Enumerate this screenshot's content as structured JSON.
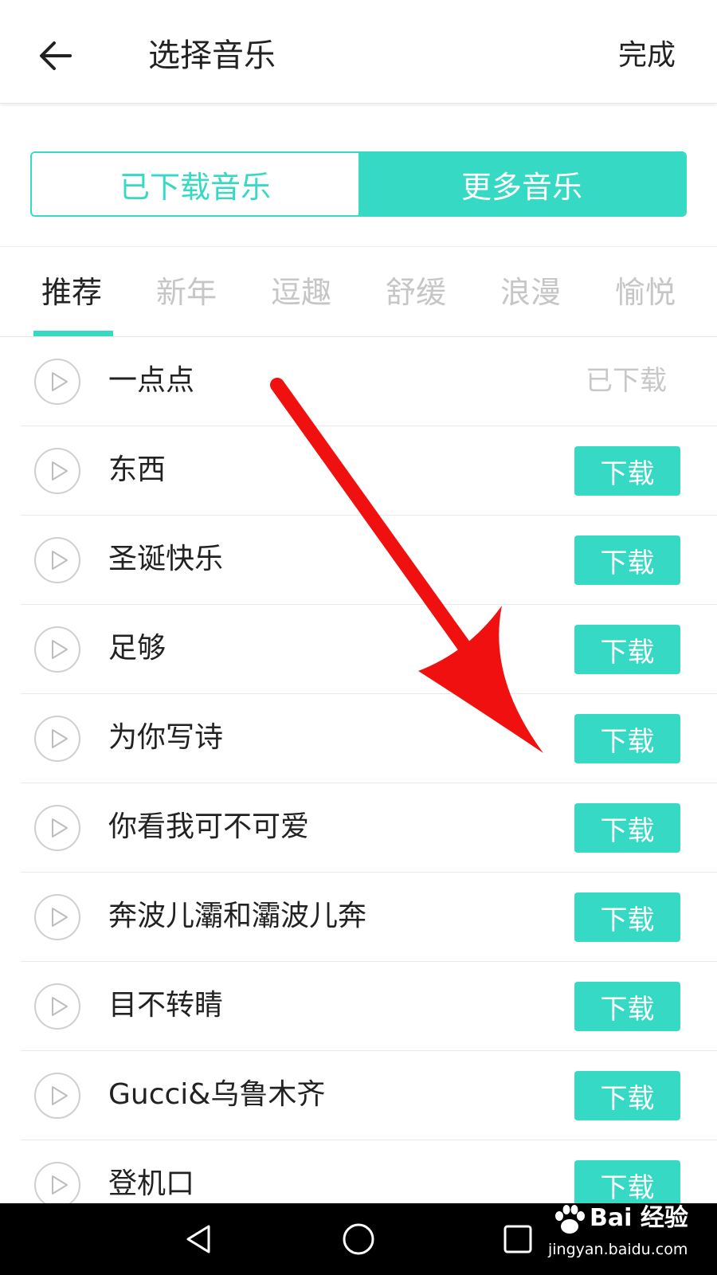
{
  "header": {
    "title": "选择音乐",
    "done_label": "完成"
  },
  "segment": {
    "left_label": "已下载音乐",
    "right_label": "更多音乐"
  },
  "tabs": [
    {
      "label": "推荐",
      "active": true
    },
    {
      "label": "新年",
      "active": false
    },
    {
      "label": "逗趣",
      "active": false
    },
    {
      "label": "舒缓",
      "active": false
    },
    {
      "label": "浪漫",
      "active": false
    },
    {
      "label": "愉悦",
      "active": false
    }
  ],
  "songs": [
    {
      "title": "一点点",
      "status": "已下载"
    },
    {
      "title": "东西",
      "action": "下载"
    },
    {
      "title": "圣诞快乐",
      "action": "下载"
    },
    {
      "title": "足够",
      "action": "下载"
    },
    {
      "title": "为你写诗",
      "action": "下载"
    },
    {
      "title": "你看我可不可爱",
      "action": "下载"
    },
    {
      "title": "奔波儿灞和灞波儿奔",
      "action": "下载"
    },
    {
      "title": "目不转睛",
      "action": "下载"
    },
    {
      "title": "Gucci&乌鲁木齐",
      "action": "下载"
    },
    {
      "title": "登机口",
      "action": "下载"
    }
  ],
  "watermark": {
    "brand": "Bai 经验",
    "url": "jingyan.baidu.com"
  },
  "colors": {
    "accent": "#36d9c3",
    "arrow": "#f01010",
    "nav_bar": "#000000"
  }
}
